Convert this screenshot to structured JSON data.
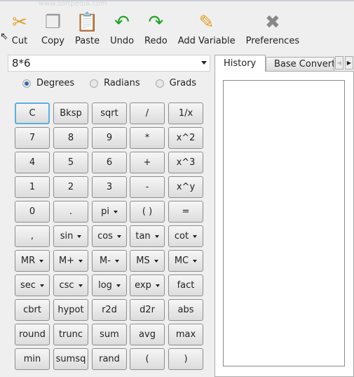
{
  "watermark": "www.softpedia.com",
  "toolbar": [
    {
      "label": "Cut",
      "icon": "scissors-icon",
      "glyph": "✂",
      "color": "#e0a020"
    },
    {
      "label": "Copy",
      "icon": "copy-icon",
      "glyph": "❐",
      "color": "#999"
    },
    {
      "label": "Paste",
      "icon": "paste-icon",
      "glyph": "📋",
      "color": "#d09020"
    },
    {
      "label": "Undo",
      "icon": "undo-icon",
      "glyph": "↶",
      "color": "#22a022"
    },
    {
      "label": "Redo",
      "icon": "redo-icon",
      "glyph": "↷",
      "color": "#22a022"
    },
    {
      "label": "Add Variable",
      "icon": "add-variable-icon",
      "glyph": "✎",
      "color": "#e0a020"
    },
    {
      "label": "Preferences",
      "icon": "tools-icon",
      "glyph": "✖",
      "color": "#888"
    }
  ],
  "expression": "8*6",
  "angle_modes": [
    {
      "label": "Degrees",
      "selected": true
    },
    {
      "label": "Radians",
      "selected": false
    },
    {
      "label": "Grads",
      "selected": false
    }
  ],
  "buttons": [
    [
      {
        "l": "C"
      },
      {
        "l": "Bksp"
      },
      {
        "l": "sqrt"
      },
      {
        "l": "/"
      },
      {
        "l": "1/x"
      }
    ],
    [
      {
        "l": "7"
      },
      {
        "l": "8"
      },
      {
        "l": "9"
      },
      {
        "l": "*"
      },
      {
        "l": "x^2"
      }
    ],
    [
      {
        "l": "4"
      },
      {
        "l": "5"
      },
      {
        "l": "6"
      },
      {
        "l": "+"
      },
      {
        "l": "x^3"
      }
    ],
    [
      {
        "l": "1"
      },
      {
        "l": "2"
      },
      {
        "l": "3"
      },
      {
        "l": "-"
      },
      {
        "l": "x^y"
      }
    ],
    [
      {
        "l": "0"
      },
      {
        "l": "."
      },
      {
        "l": "pi",
        "dd": true
      },
      {
        "l": "( )"
      },
      {
        "l": "="
      }
    ],
    [
      {
        "l": ","
      },
      {
        "l": "sin",
        "dd": true
      },
      {
        "l": "cos",
        "dd": true
      },
      {
        "l": "tan",
        "dd": true
      },
      {
        "l": "cot",
        "dd": true
      }
    ],
    [
      {
        "l": "MR",
        "dd": true
      },
      {
        "l": "M+",
        "dd": true
      },
      {
        "l": "M-",
        "dd": true
      },
      {
        "l": "MS",
        "dd": true
      },
      {
        "l": "MC",
        "dd": true
      }
    ],
    [
      {
        "l": "sec",
        "dd": true
      },
      {
        "l": "csc",
        "dd": true
      },
      {
        "l": "log",
        "dd": true
      },
      {
        "l": "exp",
        "dd": true
      },
      {
        "l": "fact"
      }
    ],
    [
      {
        "l": "cbrt"
      },
      {
        "l": "hypot"
      },
      {
        "l": "r2d"
      },
      {
        "l": "d2r"
      },
      {
        "l": "abs"
      }
    ],
    [
      {
        "l": "round"
      },
      {
        "l": "trunc"
      },
      {
        "l": "sum"
      },
      {
        "l": "avg"
      },
      {
        "l": "max"
      }
    ],
    [
      {
        "l": "min"
      },
      {
        "l": "sumsq"
      },
      {
        "l": "rand"
      },
      {
        "l": "("
      },
      {
        "l": ")"
      }
    ]
  ],
  "tabs": [
    {
      "label": "History",
      "active": true
    },
    {
      "label": "Base Converter",
      "active": false
    }
  ]
}
